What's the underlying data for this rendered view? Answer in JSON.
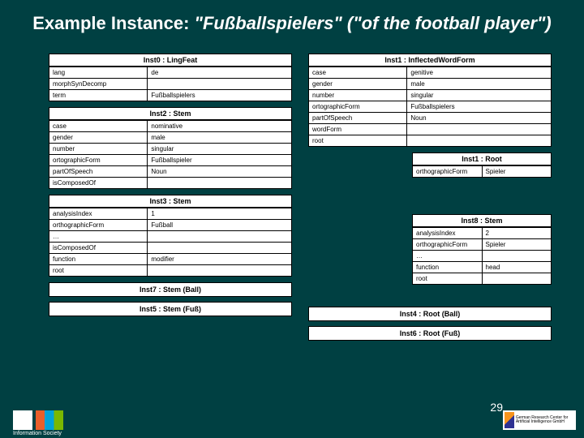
{
  "title_plain": "Example Instance: ",
  "title_ital": "\"Fußballspielers\" (\"of the football player\")",
  "page": "29",
  "footer_label": "Information Society",
  "dfki_label": "German Research Center for Artificial Intelligence GmbH",
  "inst0": {
    "hdr": "Inst0 : LingFeat",
    "rows": [
      {
        "k": "lang",
        "v": "de"
      },
      {
        "k": "morphSynDecomp",
        "v": ""
      },
      {
        "k": "term",
        "v": "Fußballspielers"
      }
    ]
  },
  "inst1": {
    "hdr": "Inst1 : InflectedWordForm",
    "rows": [
      {
        "k": "case",
        "v": "genitive"
      },
      {
        "k": "gender",
        "v": "male"
      },
      {
        "k": "number",
        "v": "singular"
      },
      {
        "k": "ortographicForm",
        "v": "Fußballspielers"
      },
      {
        "k": "partOfSpeech",
        "v": "Noun"
      },
      {
        "k": "wordForm",
        "v": ""
      },
      {
        "k": "root",
        "v": ""
      }
    ]
  },
  "inst2": {
    "hdr": "Inst2 : Stem",
    "rows": [
      {
        "k": "case",
        "v": "nominative"
      },
      {
        "k": "gender",
        "v": "male"
      },
      {
        "k": "number",
        "v": "singular"
      },
      {
        "k": "ortographicForm",
        "v": "Fußballspieler"
      },
      {
        "k": "partOfSpeech",
        "v": "Noun"
      },
      {
        "k": "isComposedOf",
        "v": ""
      }
    ]
  },
  "inst1root": {
    "hdr": "Inst1 : Root",
    "rows": [
      {
        "k": "orthographicForm",
        "v": "Spieler"
      }
    ]
  },
  "inst3": {
    "hdr": "Inst3 : Stem",
    "rows": [
      {
        "k": "analysisIndex",
        "v": "1"
      },
      {
        "k": "orthographicForm",
        "v": "Fußball"
      },
      {
        "k": "…",
        "v": ""
      },
      {
        "k": "isComposedOf",
        "v": ""
      },
      {
        "k": "function",
        "v": "modifier"
      },
      {
        "k": "root",
        "v": ""
      }
    ]
  },
  "inst8": {
    "hdr": "Inst8 : Stem",
    "rows": [
      {
        "k": "analysisIndex",
        "v": "2"
      },
      {
        "k": "orthographicForm",
        "v": "Spieler"
      },
      {
        "k": "…",
        "v": ""
      },
      {
        "k": "function",
        "v": "head"
      },
      {
        "k": "root",
        "v": ""
      }
    ]
  },
  "bars": {
    "inst7": "Inst7 : Stem (Ball)",
    "inst5": "Inst5 : Stem (Fuß)",
    "inst4": "Inst4 : Root (Ball)",
    "inst6": "Inst6 : Root (Fuß)"
  }
}
